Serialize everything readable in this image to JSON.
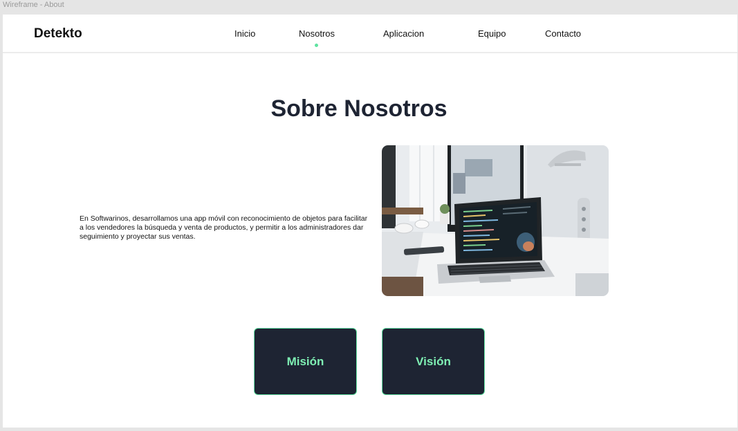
{
  "window": {
    "title": "Wireframe - About"
  },
  "navbar": {
    "brand": "Detekto",
    "items": [
      {
        "label": "Inicio"
      },
      {
        "label": "Nosotros",
        "active": true
      },
      {
        "label": "Aplicacion"
      },
      {
        "label": "Equipo"
      },
      {
        "label": "Contacto"
      }
    ],
    "active_indicator_color": "#5fe3a1"
  },
  "main": {
    "title": "Sobre Nosotros",
    "description": "En Softwarinos, desarrollamos una app móvil con reconocimiento de objetos para facilitar a los vendedores la búsqueda y venta de productos, y permitir a los administradores dar seguimiento y proyectar sus ventas.",
    "image": {
      "subject": "laptop-on-desk-photo"
    },
    "cards": [
      {
        "label": "Misión"
      },
      {
        "label": "Visión"
      }
    ]
  },
  "colors": {
    "dark_navy": "#1e2433",
    "accent_green": "#7ff0b4",
    "accent_border": "#5fe3a1",
    "background": "#ffffff"
  }
}
